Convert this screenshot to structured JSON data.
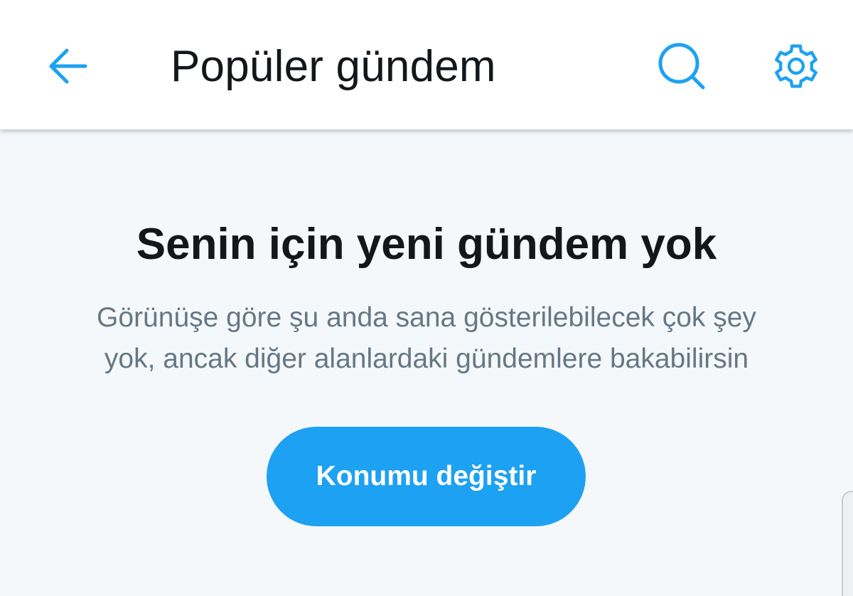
{
  "header": {
    "title": "Popüler gündem",
    "back_icon": "arrow-left-icon",
    "search_icon": "search-icon",
    "settings_icon": "gear-icon"
  },
  "empty_state": {
    "title": "Senin için yeni gündem yok",
    "message_lines": [
      "Görünüşe göre şu anda sana gösterilebilecek çok şey",
      "yok, ancak diğer alanlardaki gündemlere bakabilirsin"
    ],
    "button_label": "Konumu değiştir"
  },
  "colors": {
    "accent": "#1da1f2",
    "title_text": "#14171a",
    "secondary_text": "#657786",
    "background": "#f5f8fa",
    "header_background": "#ffffff"
  }
}
